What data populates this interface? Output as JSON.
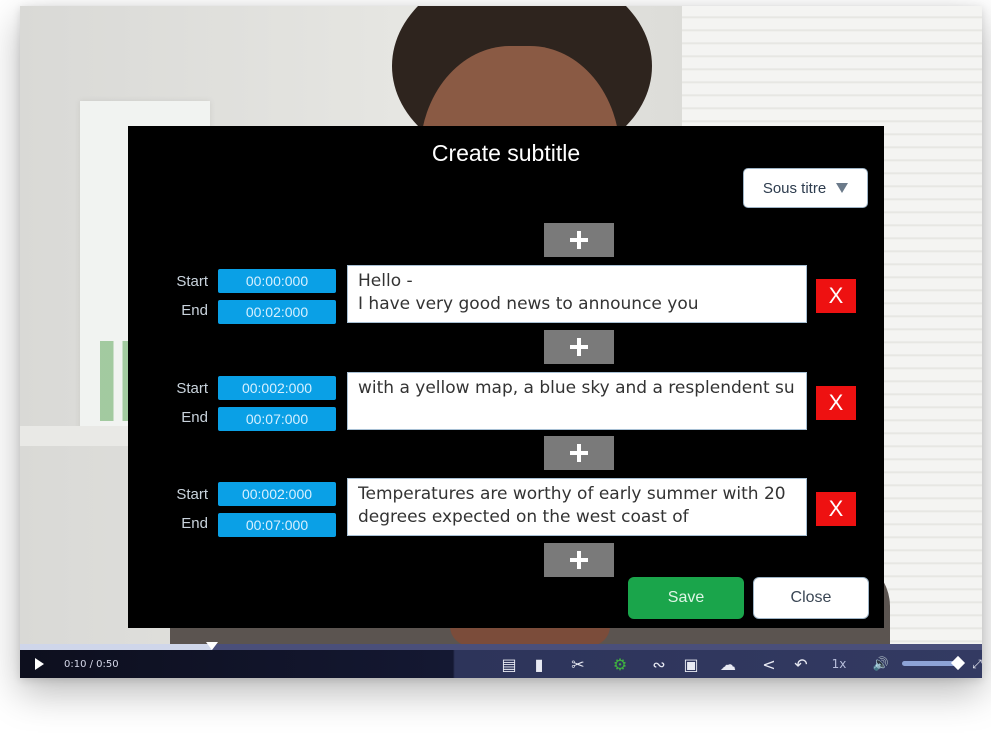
{
  "modal": {
    "title": "Create subtitle",
    "language_select": {
      "value": "Sous titre"
    },
    "labels": {
      "start": "Start",
      "end": "End"
    },
    "add_label": "+",
    "delete_label": "X",
    "rows": [
      {
        "start": "00:00:000",
        "end": "00:02:000",
        "lines": [
          "Hello -",
          "I have very good news to announce you"
        ]
      },
      {
        "start": "00:002:000",
        "end": "00:07:000",
        "lines": [
          "with a yellow map, a blue sky and a resplendent sun.",
          ""
        ]
      },
      {
        "start": "00:002:000",
        "end": "00:07:000",
        "lines": [
          "Temperatures are worthy of early summer with 20",
          "degrees expected on the west coast of"
        ]
      }
    ],
    "save_label": "Save",
    "close_label": "Close"
  },
  "player": {
    "timecode": "0:10  /  0:50",
    "progress_fraction": 0.2,
    "speed": "1x",
    "volume_fraction": 1.0,
    "icons": [
      "play-icon",
      "chapters-icon",
      "comment-icon",
      "scissors-icon",
      "settings-gear-icon",
      "wrench-icon",
      "screenshot-icon",
      "download-icon",
      "share-icon",
      "replay-icon",
      "volume-icon",
      "fullscreen-icon"
    ]
  },
  "colors": {
    "modal_bg": "#000000",
    "time_field": "#0aa0e6",
    "delete": "#ee1111",
    "save": "#1aa54b",
    "add_button": "#7a7a7a"
  }
}
